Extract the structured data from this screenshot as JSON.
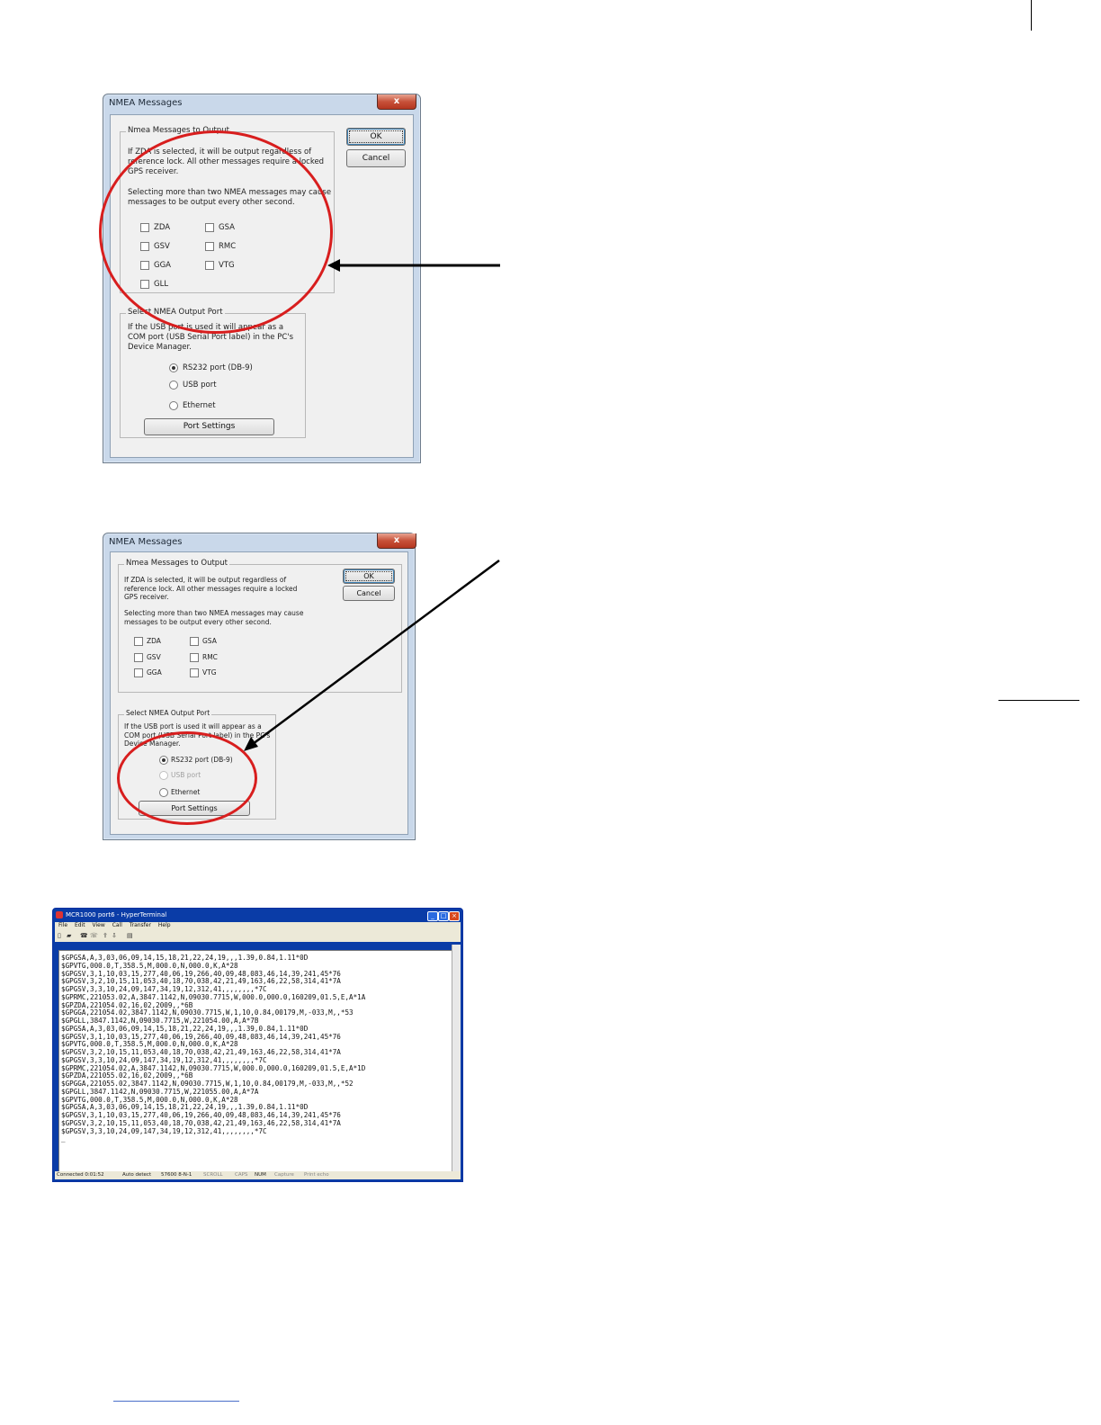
{
  "dialog1": {
    "title": "NMEA Messages",
    "close": "x",
    "ok": "OK",
    "cancel": "Cancel",
    "group1_legend": "Nmea Messages to Output",
    "zda_note": [
      "If ZDA is selected, it will be output regardless of",
      "reference lock. All other messages require a locked",
      "GPS receiver."
    ],
    "multi_note": [
      "Selecting more than two NMEA messages may cause",
      "messages to be output every other second."
    ],
    "messages": [
      "ZDA",
      "GSA",
      "GSV",
      "RMC",
      "GGA",
      "VTG",
      "GLL"
    ],
    "group2_legend": "Select NMEA Output Port",
    "port_note": [
      "If the USB port is used it will appear as a",
      "COM port (USB Serial Port label) in the PC's",
      "Device Manager."
    ],
    "ports": [
      "RS232 port (DB-9)",
      "USB port",
      "Ethernet"
    ],
    "selected_port": "RS232 port (DB-9)",
    "port_settings": "Port Settings"
  },
  "dialog2": {
    "title": "NMEA Messages",
    "close": "x",
    "ok": "OK",
    "cancel": "Cancel",
    "group1_legend": "Nmea Messages to Output",
    "zda_note": [
      "If ZDA is selected, it will be output regardless of",
      "reference lock. All other messages require a locked",
      "GPS receiver."
    ],
    "multi_note": [
      "Selecting more than two NMEA messages may cause",
      "messages to be output every other second."
    ],
    "messages": [
      "ZDA",
      "GSA",
      "GSV",
      "RMC",
      "GGA",
      "VTG"
    ],
    "group2_legend": "Select NMEA Output Port",
    "port_note": [
      "If the USB port is used it will appear as a",
      "COM port (USB Serial Port label) in the PC's",
      "Device Manager."
    ],
    "ports": [
      "RS232 port (DB-9)",
      "USB port",
      "Ethernet"
    ],
    "selected_port": "RS232 port (DB-9)",
    "disabled_port": "USB port",
    "port_settings": "Port Settings"
  },
  "terminal": {
    "title": "MCR1000 port6 - HyperTerminal",
    "menu": [
      "File",
      "Edit",
      "View",
      "Call",
      "Transfer",
      "Help"
    ],
    "toolbar_icons": [
      "new-icon",
      "open-icon",
      "disconnect-icon",
      "call-icon",
      "send-icon",
      "receive-icon",
      "properties-icon"
    ],
    "lines": [
      "$GPGSA,A,3,03,06,09,14,15,18,21,22,24,19,,,1.39,0.84,1.11*0D",
      "$GPVTG,000.0,T,358.5,M,000.0,N,000.0,K,A*28",
      "$GPGSV,3,1,10,03,15,277,40,06,19,266,40,09,48,083,46,14,39,241,45*76",
      "$GPGSV,3,2,10,15,11,053,40,18,70,038,42,21,49,163,46,22,58,314,41*7A",
      "$GPGSV,3,3,10,24,09,147,34,19,12,312,41,,,,,,,,*7C",
      "$GPRMC,221053.02,A,3847.1142,N,09030.7715,W,000.0,000.0,160209,01.5,E,A*1A",
      "$GPZDA,221054.02,16,02,2009,,*6B",
      "$GPGGA,221054.02,3847.1142,N,09030.7715,W,1,10,0.84,00179,M,-033,M,,*53",
      "$GPGLL,3847.1142,N,09030.7715,W,221054.00,A,A*7B",
      "$GPGSA,A,3,03,06,09,14,15,18,21,22,24,19,,,1.39,0.84,1.11*0D",
      "$GPGSV,3,1,10,03,15,277,40,06,19,266,40,09,48,083,46,14,39,241,45*76",
      "$GPVTG,000.0,T,358.5,M,000.0,N,000.0,K,A*28",
      "$GPGSV,3,2,10,15,11,053,40,18,70,038,42,21,49,163,46,22,58,314,41*7A",
      "$GPGSV,3,3,10,24,09,147,34,19,12,312,41,,,,,,,,*7C",
      "$GPRMC,221054.02,A,3847.1142,N,09030.7715,W,000.0,000.0,160209,01.5,E,A*1D",
      "$GPZDA,221055.02,16,02,2009,,*6B",
      "$GPGGA,221055.02,3847.1142,N,09030.7715,W,1,10,0.84,00179,M,-033,M,,*52",
      "$GPGLL,3847.1142,N,09030.7715,W,221055.00,A,A*7A",
      "$GPVTG,000.0,T,358.5,M,000.0,N,000.0,K,A*28",
      "$GPGSA,A,3,03,06,09,14,15,18,21,22,24,19,,,1.39,0.84,1.11*0D",
      "$GPGSV,3,1,10,03,15,277,40,06,19,266,40,09,48,083,46,14,39,241,45*76",
      "$GPGSV,3,2,10,15,11,053,40,18,70,038,42,21,49,163,46,22,58,314,41*7A",
      "$GPGSV,3,3,10,24,09,147,34,19,12,312,41,,,,,,,,*7C",
      "_"
    ],
    "status": [
      "Connected 0:01:52",
      "Auto detect",
      "57600 8-N-1",
      "SCROLL",
      "CAPS",
      "NUM",
      "Capture",
      "Print echo"
    ]
  },
  "colors": {
    "annotation_ring": "#d81e1e",
    "arrow": "#000000",
    "title_bar": "#0a3ca7"
  }
}
